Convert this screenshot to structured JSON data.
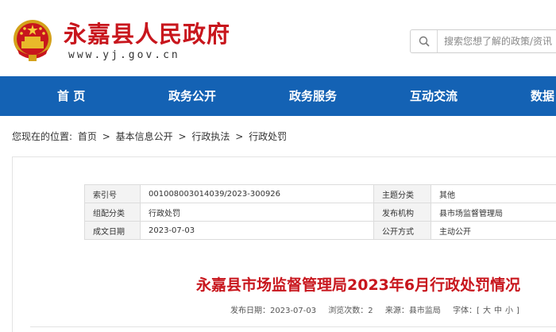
{
  "header": {
    "site_name": "永嘉县人民政府",
    "site_url": "www.yj.gov.cn",
    "search_placeholder": "搜索您想了解的政策/资讯"
  },
  "nav": {
    "items": [
      {
        "label": "首 页"
      },
      {
        "label": "政务公开"
      },
      {
        "label": "政务服务"
      },
      {
        "label": "互动交流"
      },
      {
        "label": "数据"
      }
    ]
  },
  "breadcrumb": {
    "prefix": "您现在的位置:",
    "items": [
      "首页",
      "基本信息公开",
      "行政执法",
      "行政处罚"
    ],
    "separator": ">"
  },
  "info": {
    "index_label": "索引号",
    "index_value": "001008003014039/2023-300926",
    "topic_label": "主题分类",
    "topic_value": "其他",
    "org_label": "组配分类",
    "org_value": "行政处罚",
    "issuer_label": "发布机构",
    "issuer_value": "县市场监督管理局",
    "date_label": "成文日期",
    "date_value": "2023-07-03",
    "mode_label": "公开方式",
    "mode_value": "主动公开"
  },
  "article": {
    "title": "永嘉县市场监督管理局2023年6月行政处罚情况",
    "publish_date": "发布日期：2023-07-03",
    "views": "浏览次数：2",
    "source": "来源：县市监局",
    "font_label": "字体：[",
    "font_large": "大",
    "font_medium": "中",
    "font_small": "小",
    "font_close": "]"
  },
  "colors": {
    "brand_red": "#c8161d",
    "nav_blue": "#1462b4"
  },
  "icons": {
    "emblem": "national-emblem-icon",
    "search": "search-icon"
  }
}
